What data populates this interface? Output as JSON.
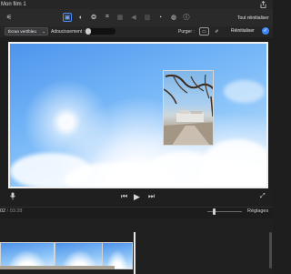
{
  "window": {
    "title": "Mon film 1"
  },
  "toolbar": {
    "tools": [
      {
        "name": "magic-wand-icon",
        "glyph": "⚟"
      },
      {
        "name": "crop-fit-icon",
        "glyph": "▣"
      },
      {
        "name": "color-balance-icon",
        "glyph": "◐"
      },
      {
        "name": "color-correction-icon",
        "glyph": "❂"
      },
      {
        "name": "crop-icon",
        "glyph": "⌗"
      },
      {
        "name": "stabilization-icon",
        "glyph": "▦"
      },
      {
        "name": "volume-icon",
        "glyph": "◀"
      },
      {
        "name": "equalizer-icon",
        "glyph": "▥"
      },
      {
        "name": "speed-icon",
        "glyph": "◔"
      },
      {
        "name": "filter-icon",
        "glyph": "◍"
      },
      {
        "name": "info-icon",
        "glyph": "ⓘ"
      }
    ],
    "reset_all": "Tout réinitialiser"
  },
  "options": {
    "mode_select": "Écran vert/bleu",
    "smoothing_label": "Adoucissement :",
    "smoothing_value": 0.0,
    "cleanup_label": "Purger :",
    "reset": "Réinitialiser"
  },
  "playback": {
    "current": "02",
    "separator": "/",
    "duration": "03:28"
  },
  "timeline": {
    "settings": "Réglages"
  },
  "colors": {
    "accent": "#3f86f7",
    "background": "#1e1e1f"
  }
}
